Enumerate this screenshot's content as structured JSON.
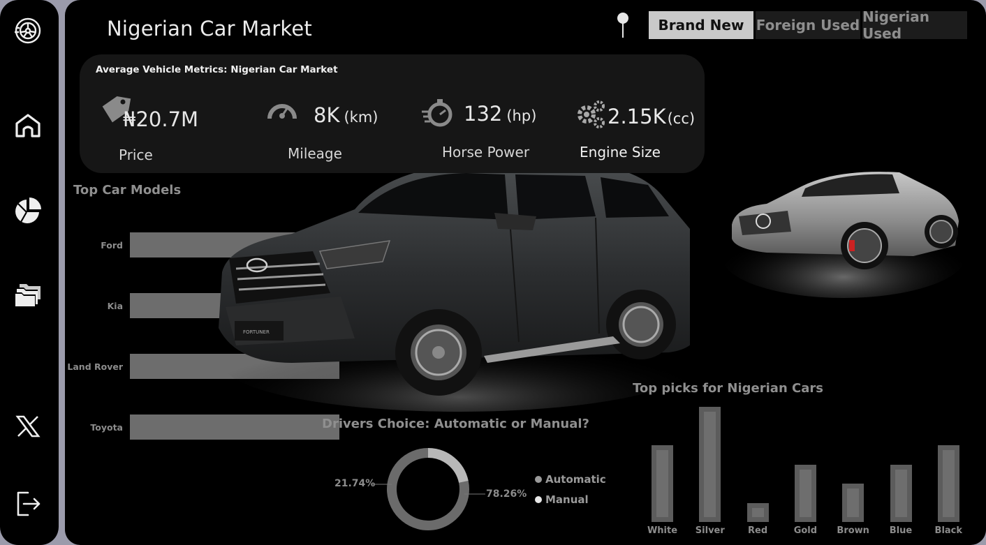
{
  "app": {
    "title": "Nigerian Car Market"
  },
  "sidebar": {
    "items": [
      {
        "icon": "wheel-logo-icon"
      },
      {
        "icon": "home-icon"
      },
      {
        "icon": "pie-chart-icon"
      },
      {
        "icon": "folders-icon"
      },
      {
        "icon": "x-logo-icon"
      },
      {
        "icon": "logout-icon"
      }
    ]
  },
  "header": {
    "tabs": [
      {
        "label": "Brand New",
        "active": true
      },
      {
        "label": "Foreign Used",
        "active": false
      },
      {
        "label": "Nigerian Used",
        "active": false
      }
    ]
  },
  "metrics": {
    "title": "Average Vehicle Metrics: Nigerian Car Market",
    "price": {
      "value": "₦20.7M",
      "label": "Price",
      "icon": "price-tag-icon"
    },
    "mileage": {
      "value": "8K",
      "unit": "(km)",
      "label": "Mileage",
      "icon": "odometer-icon"
    },
    "horsepower": {
      "value": "132",
      "unit": "(hp)",
      "label": "Horse Power",
      "icon": "stopwatch-icon"
    },
    "engine": {
      "value": "2.15K",
      "unit": "(cc)",
      "label": "Engine Size",
      "icon": "gears-icon"
    }
  },
  "chart_data": [
    {
      "type": "bar",
      "orientation": "horizontal",
      "title": "Top Car Models",
      "categories": [
        "Ford",
        "Kia",
        "Land Rover",
        "Toyota"
      ],
      "values": [
        1,
        1,
        1,
        1
      ]
    },
    {
      "type": "pie",
      "variant": "donut",
      "title": "Drivers Choice: Automatic or Manual?",
      "categories": [
        "Automatic",
        "Manual"
      ],
      "values": [
        78.26,
        21.74
      ],
      "labels": [
        "78.26%",
        "21.74%"
      ],
      "colors": [
        "#6b6b6b",
        "#b8b8b8"
      ]
    },
    {
      "type": "bar",
      "title": "Top picks for Nigerian Cars",
      "categories": [
        "White",
        "Silver",
        "Red",
        "Gold",
        "Brown",
        "Blue",
        "Black"
      ],
      "values": [
        4,
        6,
        1,
        3,
        2,
        3,
        4
      ]
    }
  ],
  "colors": {
    "background": "#000000",
    "frame": "#9b9bab",
    "card": "#161616",
    "bar": "#6d6d6d",
    "active_tab": "#c9c9c9"
  }
}
